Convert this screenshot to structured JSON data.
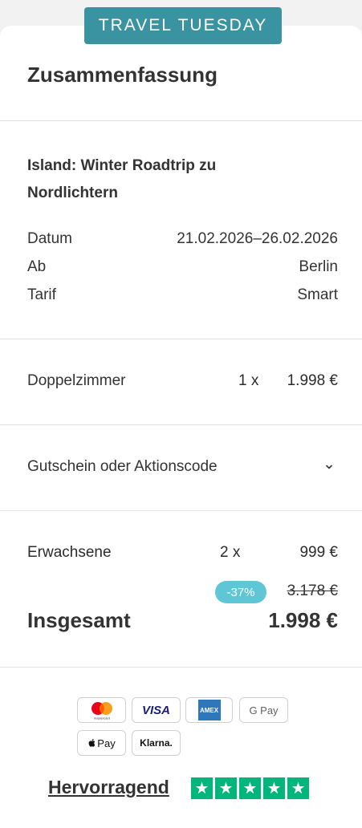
{
  "promo_badge": "TRAVEL TUESDAY",
  "summary": {
    "title": "Zusammenfassung",
    "trip_name": "Island: Winter Roadtrip zu Nordlichtern",
    "details": [
      {
        "label": "Datum",
        "value": "21.02.2026–26.02.2026"
      },
      {
        "label": "Ab",
        "value": "Berlin"
      },
      {
        "label": "Tarif",
        "value": "Smart"
      }
    ]
  },
  "room": {
    "label": "Doppelzimmer",
    "qty": "1 x",
    "price": "1.998 €"
  },
  "voucher": {
    "label": "Gutschein oder Aktionscode"
  },
  "travellers": {
    "label": "Erwachsene",
    "qty": "2 x",
    "price": "999 €"
  },
  "discount": {
    "badge": "-37%",
    "old_price": "3.178 €"
  },
  "total": {
    "label": "Insgesamt",
    "value": "1.998 €"
  },
  "payment_methods": [
    "mastercard",
    "VISA",
    "AMEX",
    "G Pay",
    "Pay",
    "Klarna."
  ],
  "rating": {
    "label": "Hervorragend",
    "stars": 5
  },
  "colors": {
    "promo": "#3a93a0",
    "discount_badge": "#5fc6d6",
    "trustpilot_green": "#00b67a"
  }
}
